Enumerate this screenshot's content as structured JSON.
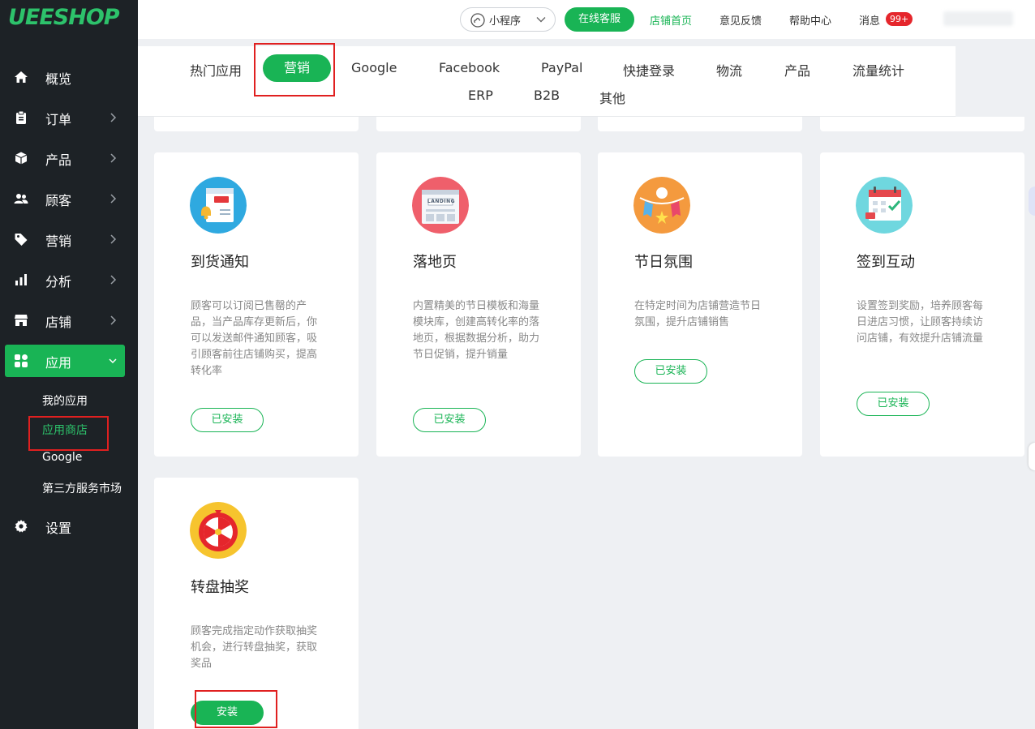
{
  "brand": {
    "logo_text": "UEESHOP",
    "accent": "#19b455"
  },
  "sidebar": {
    "items": [
      {
        "label": "概览",
        "icon": "home-icon",
        "has_arrow": false
      },
      {
        "label": "订单",
        "icon": "clipboard-icon",
        "has_arrow": true
      },
      {
        "label": "产品",
        "icon": "box-icon",
        "has_arrow": true
      },
      {
        "label": "顾客",
        "icon": "users-icon",
        "has_arrow": true
      },
      {
        "label": "营销",
        "icon": "tag-icon",
        "has_arrow": true
      },
      {
        "label": "分析",
        "icon": "bar-chart-icon",
        "has_arrow": true
      },
      {
        "label": "店铺",
        "icon": "store-icon",
        "has_arrow": true
      },
      {
        "label": "应用",
        "icon": "apps-grid-icon",
        "has_arrow": true,
        "active": true
      }
    ],
    "sub_items": [
      "我的应用",
      "应用商店",
      "Google",
      "第三方服务市场"
    ],
    "settings_label": "设置"
  },
  "topbar": {
    "mini_program": "小程序",
    "online_service": "在线客服",
    "store_home": "店铺首页",
    "feedback": "意见反馈",
    "help_center": "帮助中心",
    "messages": "消息",
    "messages_badge": "99+"
  },
  "categories": {
    "row1": [
      "热门应用",
      "营销",
      "Google",
      "Facebook",
      "PayPal",
      "快捷登录",
      "物流",
      "产品",
      "流量统计"
    ],
    "row2": [
      "ERP",
      "B2B",
      "其他"
    ],
    "active": "营销"
  },
  "apps": [
    {
      "title": "到货通知",
      "desc": "顾客可以订阅已售罄的产品，当产品库存更新后，你可以发送邮件通知顾客，吸引顾客前往店铺购买，提高转化率",
      "button": "已安装",
      "installed": true,
      "icon": "bell-notification-icon",
      "icon_bg": "#2fa9e0"
    },
    {
      "title": "落地页",
      "desc": "内置精美的节日模板和海量模块库，创建高转化率的落地页，根据数据分析，助力节日促销，提升销量",
      "button": "已安装",
      "installed": true,
      "icon": "landing-page-icon",
      "icon_bg": "#ef5f6b",
      "icon_text": "LANDING"
    },
    {
      "title": "节日氛围",
      "desc": "在特定时间为店铺营造节日氛围，提升店铺销售",
      "button": "已安装",
      "installed": true,
      "icon": "festival-banner-icon",
      "icon_bg": "#f49a3e"
    },
    {
      "title": "签到互动",
      "desc": "设置签到奖励，培养顾客每日进店习惯，让顾客持续访问店铺，有效提升店铺流量",
      "button": "已安装",
      "installed": true,
      "icon": "calendar-checkin-icon",
      "icon_bg": "#6fd7df"
    },
    {
      "title": "转盘抽奖",
      "desc": "顾客完成指定动作获取抽奖机会，进行转盘抽奖，获取奖品",
      "button": "安装",
      "installed": false,
      "icon": "lucky-wheel-icon",
      "icon_bg": "#f6c42e"
    }
  ]
}
